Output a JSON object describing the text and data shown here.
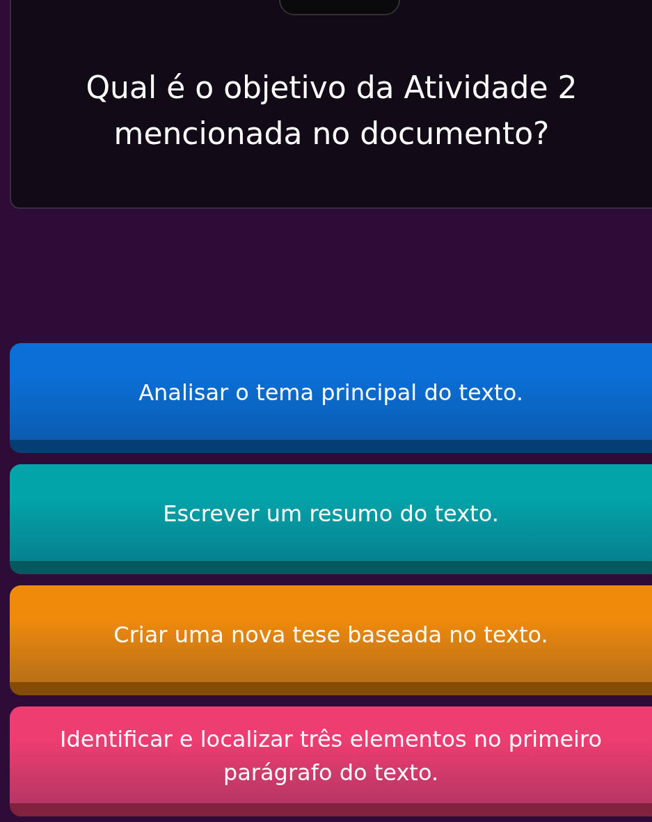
{
  "question": {
    "text": "Qual é o objetivo da Atividade 2 mencionada no documento?"
  },
  "answers": [
    {
      "text": "Analisar o tema principal do texto.",
      "color": "#0a6fd6"
    },
    {
      "text": "Escrever um resumo do texto.",
      "color": "#03a3aa"
    },
    {
      "text": "Criar uma nova tese baseada no texto.",
      "color": "#f08a0a"
    },
    {
      "text": "Identificar e localizar três elementos no primeiro parágrafo do texto.",
      "color": "#ee3d70"
    }
  ]
}
